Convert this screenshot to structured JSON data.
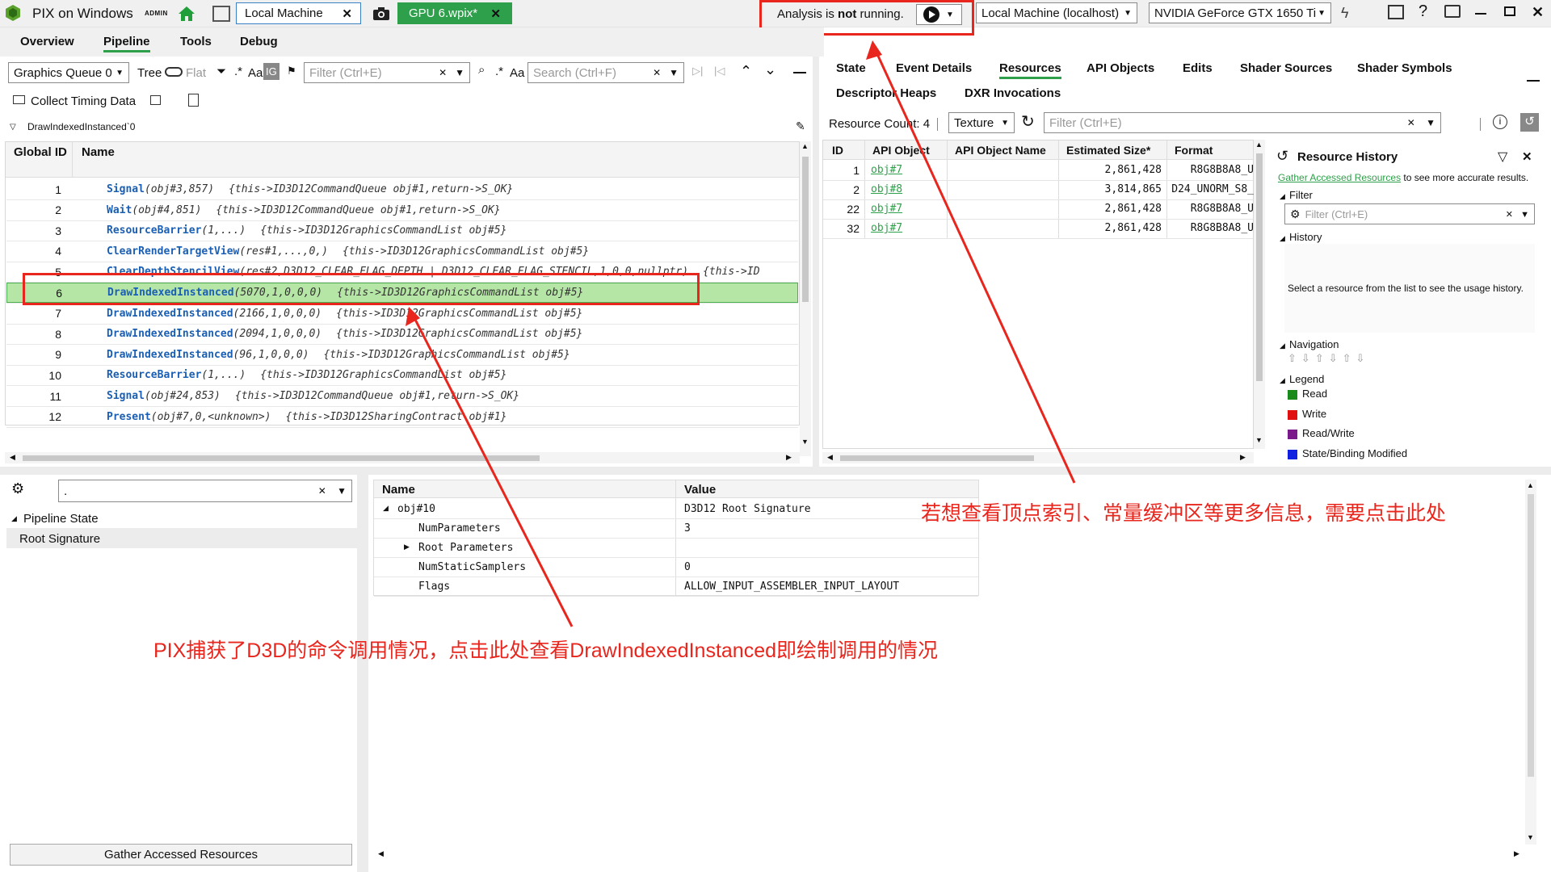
{
  "titlebar": {
    "app_title": "PIX on Windows",
    "admin_badge": "ADMIN",
    "connection_tab": "Local Machine",
    "capture_tab": "GPU 6.wpix*",
    "analysis_prefix": "Analysis is ",
    "analysis_bold": "not",
    "analysis_suffix": " running.",
    "machine_select": "Local Machine (localhost)",
    "gpu_select": "NVIDIA GeForce GTX 1650 Ti"
  },
  "menu": {
    "overview": "Overview",
    "pipeline": "Pipeline",
    "tools": "Tools",
    "debug": "Debug"
  },
  "events_toolbar": {
    "queue": "Graphics Queue 0",
    "tree": "Tree",
    "flat": "Flat",
    "regex": ".*",
    "case": "Aa",
    "ig": "IG",
    "filter_ph": "Filter (Ctrl+E)",
    "search_ph": "Search (Ctrl+F)",
    "timing": "Collect Timing Data",
    "breadcrumb": "DrawIndexedInstanced`0"
  },
  "events_table": {
    "col_id": "Global ID",
    "col_name": "Name",
    "rows": [
      {
        "id": "1",
        "fn": "Signal",
        "args": "(obj#3,857)",
        "this": "{this->ID3D12CommandQueue obj#1,return->S_OK}"
      },
      {
        "id": "2",
        "fn": "Wait",
        "args": "(obj#4,851)",
        "this": "{this->ID3D12CommandQueue obj#1,return->S_OK}"
      },
      {
        "id": "3",
        "fn": "ResourceBarrier",
        "args": "(1,...)",
        "this": "{this->ID3D12GraphicsCommandList obj#5}"
      },
      {
        "id": "4",
        "fn": "ClearRenderTargetView",
        "args": "(res#1,...,0,)",
        "this": "{this->ID3D12GraphicsCommandList obj#5}"
      },
      {
        "id": "5",
        "fn": "ClearDepthStencilView",
        "args": "(res#2,D3D12_CLEAR_FLAG_DEPTH | D3D12_CLEAR_FLAG_STENCIL,1,0,0,nullptr)",
        "this": "{this->ID"
      },
      {
        "id": "6",
        "fn": "DrawIndexedInstanced",
        "args": "(5070,1,0,0,0)",
        "this": "{this->ID3D12GraphicsCommandList obj#5}"
      },
      {
        "id": "7",
        "fn": "DrawIndexedInstanced",
        "args": "(2166,1,0,0,0)",
        "this": "{this->ID3D12GraphicsCommandList obj#5}"
      },
      {
        "id": "8",
        "fn": "DrawIndexedInstanced",
        "args": "(2094,1,0,0,0)",
        "this": "{this->ID3D12GraphicsCommandList obj#5}"
      },
      {
        "id": "9",
        "fn": "DrawIndexedInstanced",
        "args": "(96,1,0,0,0)",
        "this": "{this->ID3D12GraphicsCommandList obj#5}"
      },
      {
        "id": "10",
        "fn": "ResourceBarrier",
        "args": "(1,...)",
        "this": "{this->ID3D12GraphicsCommandList obj#5}"
      },
      {
        "id": "11",
        "fn": "Signal",
        "args": "(obj#24,853)",
        "this": "{this->ID3D12CommandQueue obj#1,return->S_OK}"
      },
      {
        "id": "12",
        "fn": "Present",
        "args": "(obj#7,0,<unknown>)",
        "this": "{this->ID3D12SharingContract obj#1}"
      }
    ]
  },
  "right_tabs": {
    "state": "State",
    "event_details": "Event Details",
    "resources": "Resources",
    "api_objects": "API Objects",
    "edits": "Edits",
    "shader_sources": "Shader Sources",
    "shader_symbols": "Shader Symbols",
    "descriptor_heaps": "Descriptor Heaps",
    "dxr": "DXR Invocations"
  },
  "resources": {
    "count_label": "Resource Count: 4",
    "type_select": "Texture",
    "filter_ph": "Filter (Ctrl+E)",
    "cols": [
      "ID",
      "API Object",
      "API Object Name",
      "Estimated Size*",
      "Format"
    ],
    "rows": [
      {
        "id": "1",
        "obj": "obj#7",
        "name": "",
        "size": "2,861,428",
        "fmt": "R8G8B8A8_U"
      },
      {
        "id": "2",
        "obj": "obj#8",
        "name": "",
        "size": "3,814,865",
        "fmt": "D24_UNORM_S8_"
      },
      {
        "id": "22",
        "obj": "obj#7",
        "name": "",
        "size": "2,861,428",
        "fmt": "R8G8B8A8_U"
      },
      {
        "id": "32",
        "obj": "obj#7",
        "name": "",
        "size": "2,861,428",
        "fmt": "R8G8B8A8_U"
      }
    ]
  },
  "history": {
    "title": "Resource History",
    "gather_link": "Gather Accessed Resources",
    "gather_suffix": " to see more accurate results.",
    "filter": "Filter",
    "filter_ph": "Filter (Ctrl+E)",
    "history": "History",
    "empty_msg": "Select a resource from the list to see the usage history.",
    "navigation": "Navigation",
    "legend": "Legend",
    "legend_items": [
      {
        "label": "Read",
        "color": "#1a8a1a"
      },
      {
        "label": "Write",
        "color": "#e01010"
      },
      {
        "label": "Read/Write",
        "color": "#7a1a8a"
      },
      {
        "label": "State/Binding Modified",
        "color": "#1020e0"
      }
    ]
  },
  "state_tree": {
    "search_value": ".",
    "pipeline_state": "Pipeline State",
    "root_signature": "Root Signature",
    "gather_button": "Gather Accessed Resources"
  },
  "props": {
    "col_name": "Name",
    "col_value": "Value",
    "rows": [
      {
        "name": "obj#10",
        "value": "D3D12 Root Signature",
        "indent": 0,
        "exp": "◢"
      },
      {
        "name": "NumParameters",
        "value": "3",
        "indent": 1,
        "exp": ""
      },
      {
        "name": "Root Parameters",
        "value": "",
        "indent": 1,
        "exp": "▶"
      },
      {
        "name": "NumStaticSamplers",
        "value": "0",
        "indent": 1,
        "exp": ""
      },
      {
        "name": "Flags",
        "value": "ALLOW_INPUT_ASSEMBLER_INPUT_LAYOUT",
        "indent": 1,
        "exp": ""
      }
    ]
  },
  "annotations": {
    "top": "若想查看顶点索引、常量缓冲区等更多信息，需要点击此处",
    "bottom": "PIX捕获了D3D的命令调用情况，点击此处查看DrawIndexedInstanced即绘制调用的情况"
  },
  "icons": [
    "pix-logo-icon",
    "home-icon",
    "window-icon",
    "camera-icon",
    "play-icon",
    "lightning-icon",
    "feedback-icon",
    "help-icon",
    "chat-icon",
    "minimize-icon",
    "restore-icon",
    "close-icon",
    "funnel-icon",
    "search-icon",
    "gear-icon",
    "refresh-icon",
    "info-icon",
    "history-icon",
    "pencil-icon"
  ]
}
